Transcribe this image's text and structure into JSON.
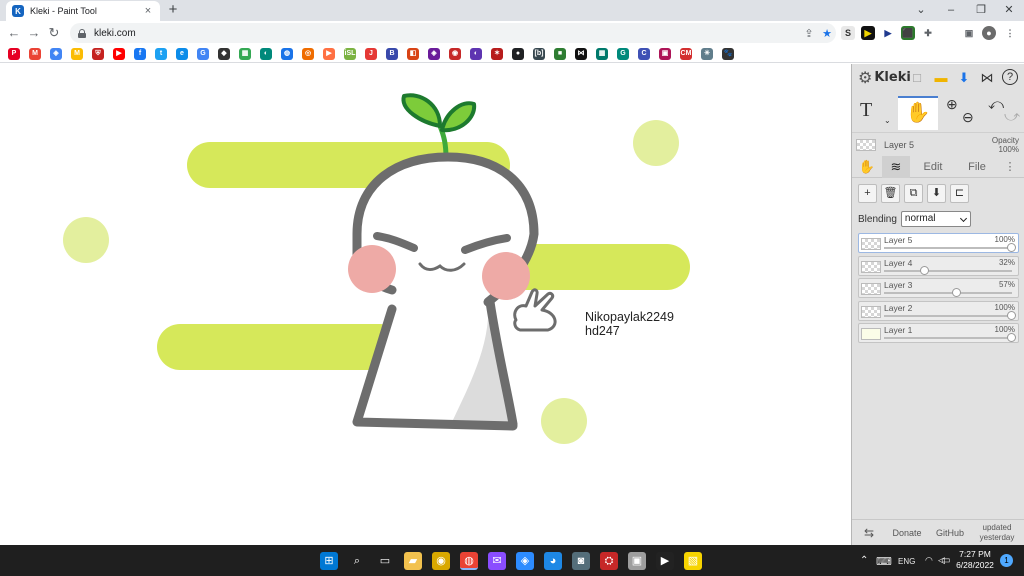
{
  "browser": {
    "tab_title": "Kleki - Paint Tool",
    "tab_favicon": "K",
    "tab_close": "×",
    "new_tab": "+",
    "url": "kleki.com",
    "window_controls": [
      "⌄",
      "–",
      "❐",
      "✕"
    ],
    "nav": {
      "back": "←",
      "forward": "→",
      "reload": "↻"
    },
    "extensions": [
      "S",
      "▶",
      "▶",
      "⬛",
      "✚",
      "▣",
      "●",
      "⋮"
    ],
    "bookmark_icons": [
      "pinterest-icon",
      "gmail-icon",
      "maps-icon",
      "ads-icon",
      "shield-icon",
      "youtube-icon",
      "facebook-icon",
      "twitter-icon",
      "edge-icon",
      "google-icon",
      "roblox-icon",
      "apps-icon",
      "app-icon",
      "app-icon",
      "app-icon",
      "app-icon",
      "isl-icon",
      "j-icon",
      "app-icon",
      "app-icon",
      "app-icon",
      "app-icon",
      "app-icon",
      "app-icon",
      "app-icon",
      "b-icon",
      "meet-icon",
      "app-icon",
      "app-icon",
      "app-icon",
      "app-icon",
      "app-icon",
      "cm-icon",
      "app-icon",
      "paw-icon"
    ],
    "bookmark_labels": [
      "P",
      "M",
      "◈",
      "M",
      "⛨",
      "▶",
      "f",
      "t",
      "e",
      "G",
      "◆",
      "▦",
      "◐",
      "◍",
      "◎",
      "▶",
      "iSL",
      "J",
      "B",
      "◧",
      "◈",
      "◉",
      "◐",
      "✶",
      "●",
      "[b]",
      "■",
      "⋈",
      "▦",
      "G",
      "C",
      "▣",
      "CM",
      "✳",
      "🐾"
    ]
  },
  "canvas": {
    "signature_line1": "Nikopaylak2249",
    "signature_line2": "hd247"
  },
  "kleki": {
    "logo": "Kleki",
    "logo_mark": "⚙",
    "header_buttons": [
      "□",
      "▬",
      "⬇",
      "⋈",
      "?"
    ],
    "tool_text": "T",
    "tool_text_caret": "⌄",
    "tool_hand": "✋",
    "zoom_in": "⊕",
    "zoom_out": "⊖",
    "undo": "⤺",
    "redo": "⤻",
    "current_layer": "Layer 5",
    "opacity_label": "Opacity",
    "opacity_value": "100%",
    "tabs": [
      "✋",
      "≋",
      "Edit",
      "File",
      "⋮"
    ],
    "actions": [
      "+",
      "🗑",
      "⧉",
      "⬇",
      "⊏"
    ],
    "blending_label": "Blending",
    "blending_value": "normal",
    "layers": [
      {
        "name": "Layer 5",
        "opacity": "100%",
        "value": 1.0,
        "selected": true,
        "thumb": "checker"
      },
      {
        "name": "Layer 4",
        "opacity": "32%",
        "value": 0.32,
        "selected": false,
        "thumb": "checker"
      },
      {
        "name": "Layer 3",
        "opacity": "57%",
        "value": 0.57,
        "selected": false,
        "thumb": "checker"
      },
      {
        "name": "Layer 2",
        "opacity": "100%",
        "value": 1.0,
        "selected": false,
        "thumb": "checker"
      },
      {
        "name": "Layer 1",
        "opacity": "100%",
        "value": 1.0,
        "selected": false,
        "thumb": "lime"
      }
    ],
    "footer": {
      "swap": "⇆",
      "donate": "Donate",
      "github": "GitHub",
      "updated": "updated yesterday"
    }
  },
  "taskbar": {
    "apps": [
      "⊞",
      "⌕",
      "▭",
      "▰",
      "◉",
      "◍",
      "✉",
      "◈",
      "◕",
      "◙",
      "⛭",
      "▣",
      "▶",
      "▧"
    ],
    "tray_chevron": "⌃",
    "tray_keyboard": "⌨",
    "language": "ENG",
    "wifi": "◠",
    "volume": "◁",
    "battery": "▭",
    "time": "7:27 PM",
    "date": "6/28/2022",
    "notification_badge": "1"
  },
  "colors": {
    "lime": "#d6e85a",
    "lime_light": "#e3ef9e",
    "blush": "#eeaaa6",
    "outline": "#6d6d6d",
    "sprout": "#3eaa3a",
    "accent": "#1a73e8"
  }
}
